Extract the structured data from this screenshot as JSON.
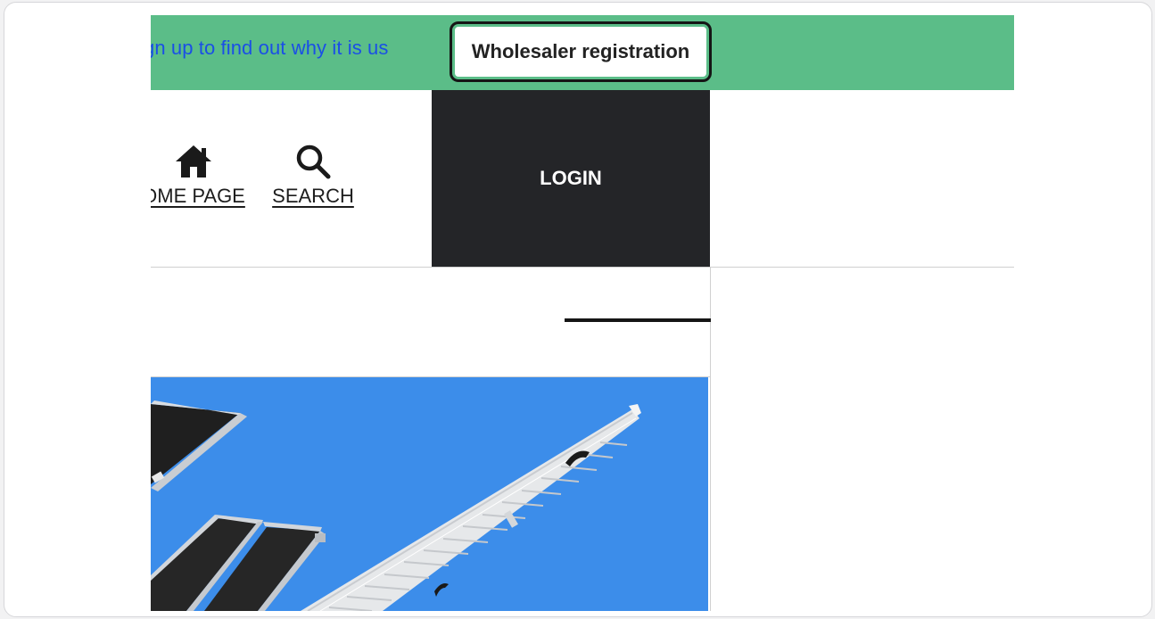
{
  "topbar": {
    "signup_text": "gn up to find out why it is us",
    "wholesale_label": "Wholesaler registration"
  },
  "nav": {
    "home_label": "OME PAGE",
    "search_label": "SEARCH"
  },
  "login": {
    "label": "LOGIN"
  },
  "colors": {
    "topbar_bg": "#5bbd88",
    "link": "#1a4fe6",
    "login_bg": "#242528",
    "image_bg": "#3c8dea"
  },
  "icons": {
    "home": "home-icon",
    "search": "search-icon"
  }
}
